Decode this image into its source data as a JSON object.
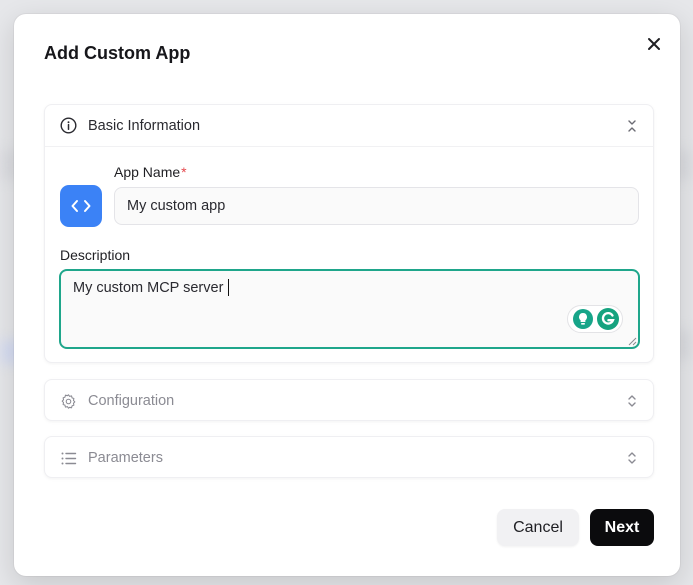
{
  "dialog": {
    "title": "Add Custom App",
    "close_icon": "close-icon"
  },
  "sections": {
    "basic": {
      "label": "Basic Information",
      "icon": "info-icon",
      "expanded": true,
      "app_icon": "code-icon",
      "app_icon_color": "#3b82f6",
      "app_name_label": "App Name",
      "required_mark": "*",
      "app_name_value": "My custom app",
      "description_label": "Description",
      "description_value": "My custom MCP server"
    },
    "configuration": {
      "label": "Configuration",
      "icon": "gear-icon",
      "expanded": false
    },
    "parameters": {
      "label": "Parameters",
      "icon": "list-icon",
      "expanded": false
    }
  },
  "footer": {
    "cancel_label": "Cancel",
    "next_label": "Next"
  },
  "colors": {
    "accent_focus": "#1fa68b",
    "required": "#e5484d",
    "primary_button": "#0b0b0d"
  }
}
